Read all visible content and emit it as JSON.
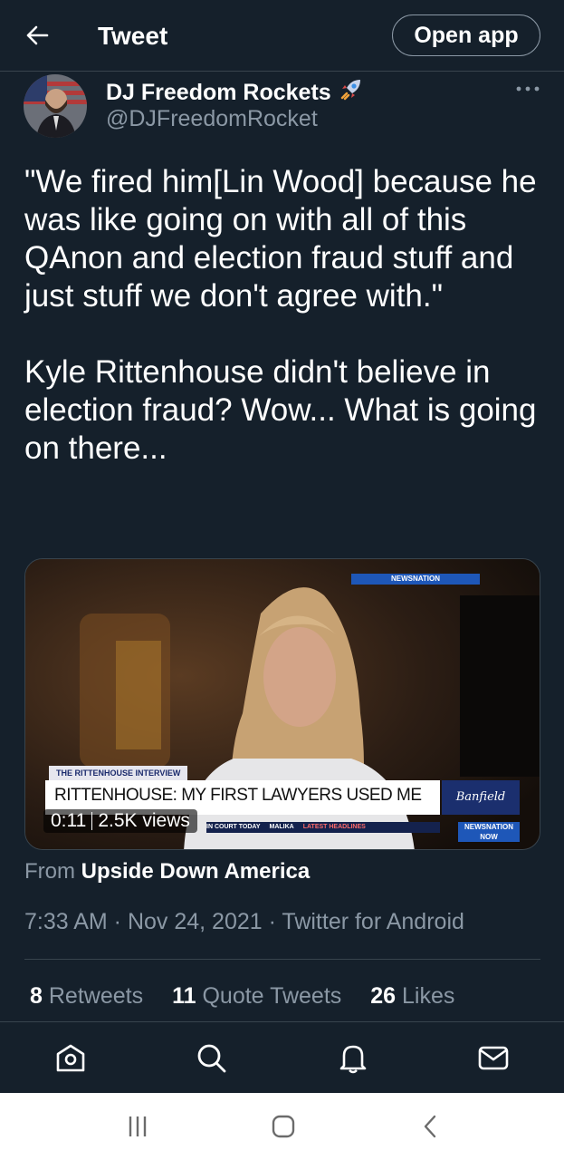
{
  "header": {
    "title": "Tweet",
    "open_app": "Open app"
  },
  "author": {
    "name": "DJ Freedom Rockets",
    "handle": "@DJFreedomRocket",
    "badge_icon": "rocket-icon"
  },
  "tweet": {
    "text": "\"We fired him[Lin Wood] because he was like going on with all of this QAnon and election fraud stuff and just stuff we don't agree with.\"\n\nKyle Rittenhouse didn't believe in election fraud? Wow... What is going on there..."
  },
  "media": {
    "network_bug": "NEWSNATION",
    "lower_third_tag": "THE RITTENHOUSE INTERVIEW",
    "headline": "RITTENHOUSE: MY FIRST LAWYERS USED ME",
    "show_logo": "Banfield",
    "ticker_1": "IN COURT TODAY",
    "ticker_2": "MALIKA",
    "ticker_3": "LATEST HEADLINES",
    "corner_logo": "NEWSNATION NOW",
    "duration": "0:11",
    "views": "2.5K views"
  },
  "source": {
    "prefix": "From",
    "name": "Upside Down America"
  },
  "meta": {
    "time_line": "7:33 AM · Nov 24, 2021 · Twitter for Android"
  },
  "stats": {
    "retweets_count": "8",
    "retweets_label": "Retweets",
    "quotes_count": "11",
    "quotes_label": "Quote Tweets",
    "likes_count": "26",
    "likes_label": "Likes"
  },
  "bottom_nav": [
    "home-icon",
    "search-icon",
    "notifications-icon",
    "messages-icon"
  ],
  "system_nav": [
    "recent-apps-icon",
    "home-button-icon",
    "back-icon"
  ],
  "colors": {
    "background": "#15202b",
    "secondary_text": "#8b98a5",
    "divider": "#38444d"
  }
}
